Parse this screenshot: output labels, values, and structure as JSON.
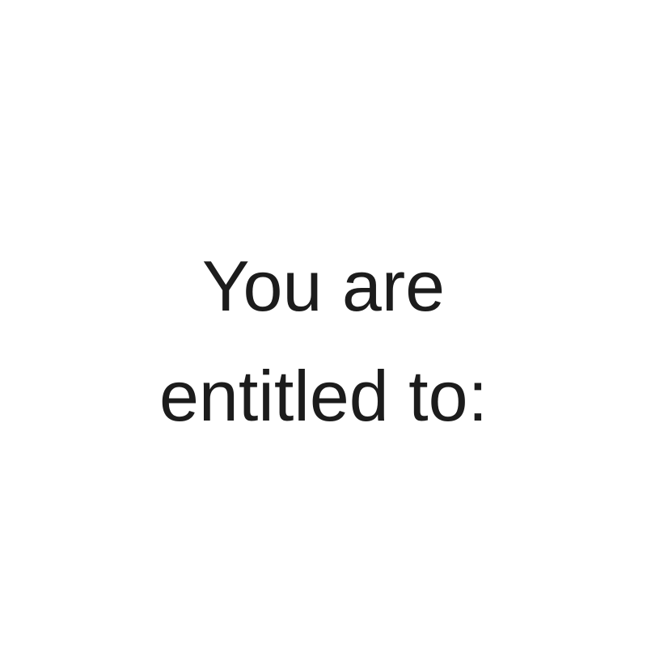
{
  "graphic": {
    "lines": [
      "You are",
      "entitled to:"
    ]
  },
  "colors": {
    "background": "#ffffff",
    "text": "#1c1c1c"
  }
}
